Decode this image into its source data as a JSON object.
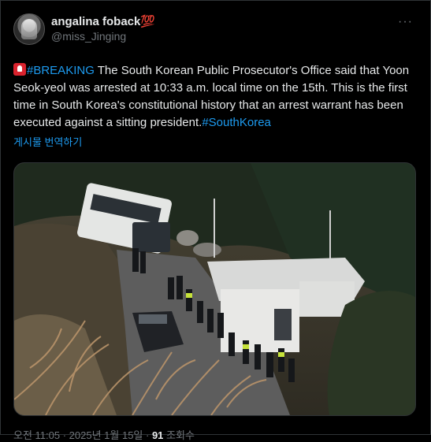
{
  "author": {
    "display_name": "angalina foback",
    "name_emoji": "💯",
    "handle": "@miss_Jinging"
  },
  "more_button": "···",
  "tweet": {
    "siren_emoji": "🚨",
    "hashtag_breaking": "#BREAKING",
    "text_main": "  The South Korean Public Prosecutor's Office said that Yoon Seok-yeol was arrested at 10:33 a.m. local time on the 15th. This is the first time in South Korea's constitutional history that an arrest warrant has been executed against a sitting president.",
    "hashtag_south_korea": "#SouthKorea",
    "translate_label": "게시물 번역하기"
  },
  "media": {
    "icon": "photo-image"
  },
  "meta": {
    "time": "오전 11:05",
    "separator": " · ",
    "date": "2025년 1월 15일",
    "separator2": " · ",
    "views_count": "91",
    "views_label": " 조회수"
  },
  "colors": {
    "background": "#000000",
    "text": "#e7e9ea",
    "muted": "#71767b",
    "link": "#1d9bf0"
  }
}
